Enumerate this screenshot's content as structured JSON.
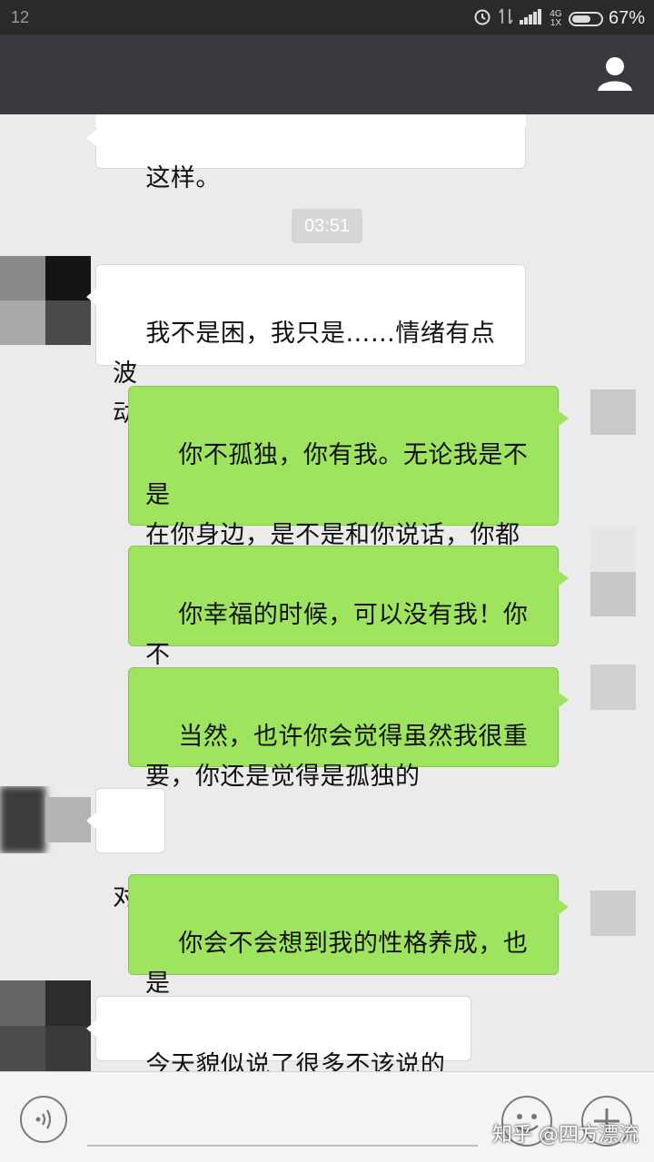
{
  "status_bar": {
    "time": "12",
    "battery_percent": "67%",
    "battery_level": 0.67,
    "network_label": "4G 1X"
  },
  "header": {
    "profile_icon": "person-icon"
  },
  "chat": {
    "timestamp": "03:51",
    "messages": [
      {
        "side": "incoming",
        "text": "这样。"
      },
      {
        "side": "incoming",
        "text": "我不是困，我只是……情绪有点波\n动"
      },
      {
        "side": "outgoing",
        "text": "你不孤独，你有我。无论我是不是\n在你身边，是不是和你说话，你都\n是在我心里。"
      },
      {
        "side": "outgoing",
        "text": "你幸福的时候，可以没有我！你不\n幸福的时候，我一定要陪着你"
      },
      {
        "side": "outgoing",
        "text": "当然，也许你会觉得虽然我很重\n要，你还是觉得是孤独的"
      },
      {
        "side": "incoming",
        "text": "对"
      },
      {
        "side": "outgoing",
        "text": "你会不会想到我的性格养成，也是\n经过大起大落的"
      },
      {
        "side": "incoming",
        "text": "今天貌似说了很多不该说的话"
      }
    ]
  },
  "input_bar": {
    "voice_icon": "voice-icon",
    "emoji_icon": "emoji-icon",
    "plus_icon": "plus-icon"
  },
  "watermark": "知乎 @四方漂流",
  "colors": {
    "outgoing_bubble": "#9fe45f",
    "incoming_bubble": "#ffffff",
    "title_bar": "#393a3f",
    "background": "#ebebeb"
  }
}
